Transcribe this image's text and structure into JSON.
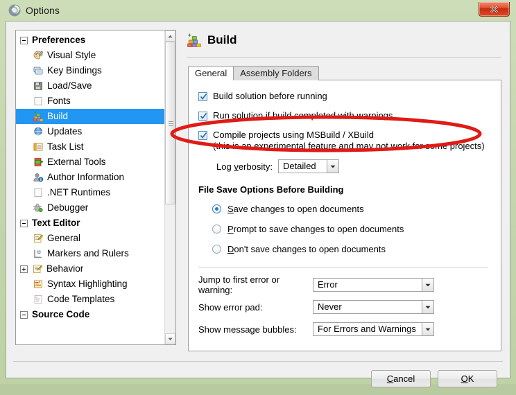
{
  "window": {
    "title": "Options",
    "icon": "monodevelop-icon",
    "close_label": "x",
    "frame_color": "#c3d5ad",
    "accent_color": "#2196f3"
  },
  "sidebar": {
    "items": [
      {
        "label": "Preferences",
        "level": 0,
        "type": "group",
        "expander": "minus",
        "icon": "none"
      },
      {
        "label": "Visual Style",
        "level": 1,
        "type": "item",
        "icon": "palette-icon"
      },
      {
        "label": "Key Bindings",
        "level": 1,
        "type": "item",
        "icon": "keyboard-icon"
      },
      {
        "label": "Load/Save",
        "level": 1,
        "type": "item",
        "icon": "disk-icon"
      },
      {
        "label": "Fonts",
        "level": 1,
        "type": "item",
        "icon": "blank-page-icon"
      },
      {
        "label": "Build",
        "level": 1,
        "type": "item",
        "icon": "build-blocks-icon",
        "selected": true
      },
      {
        "label": "Updates",
        "level": 1,
        "type": "item",
        "icon": "globe-icon"
      },
      {
        "label": "Task List",
        "level": 1,
        "type": "item",
        "icon": "list-icon"
      },
      {
        "label": "External Tools",
        "level": 1,
        "type": "item",
        "icon": "tools-icon"
      },
      {
        "label": "Author Information",
        "level": 1,
        "type": "item",
        "icon": "person-info-icon"
      },
      {
        "label": ".NET Runtimes",
        "level": 1,
        "type": "item",
        "icon": "blank-page-icon"
      },
      {
        "label": "Debugger",
        "level": 1,
        "type": "item",
        "icon": "bug-icon"
      },
      {
        "label": "Text Editor",
        "level": 0,
        "type": "group",
        "expander": "minus",
        "icon": "none"
      },
      {
        "label": "General",
        "level": 1,
        "type": "item",
        "icon": "pencil-pad-icon"
      },
      {
        "label": "Markers and Rulers",
        "level": 1,
        "type": "item",
        "icon": "ruler-icon"
      },
      {
        "label": "Behavior",
        "level": 1,
        "type": "item",
        "expander": "plus",
        "icon": "pencil-pad-icon"
      },
      {
        "label": "Syntax Highlighting",
        "level": 1,
        "type": "item",
        "icon": "highlight-icon"
      },
      {
        "label": "Code Templates",
        "level": 1,
        "type": "item",
        "icon": "template-icon"
      },
      {
        "label": "Source Code",
        "level": 0,
        "type": "group",
        "expander": "minus",
        "icon": "none"
      }
    ],
    "scrollbar": {
      "up_arrow": "▲",
      "down_arrow": "▼"
    }
  },
  "page": {
    "title": "Build",
    "icon": "build-blocks-icon",
    "tabs": [
      {
        "label": "General",
        "active": true
      },
      {
        "label": "Assembly Folders",
        "active": false
      }
    ],
    "checkboxes": [
      {
        "label": "Build solution before running",
        "checked": true
      },
      {
        "label": "Run solution if build completed with warnings",
        "checked": true
      },
      {
        "label": "Compile projects using MSBuild / XBuild",
        "sublabel": "(this is an experimental feature and may not work for some projects)",
        "checked": true,
        "annotated": true
      }
    ],
    "log_verbosity": {
      "label_before": "Log ",
      "label_accesskey": "v",
      "label_after": "erbosity:",
      "value": "Detailed"
    },
    "file_save_section": {
      "heading": "File Save Options Before Building",
      "options": [
        {
          "accesskey": "S",
          "rest": "ave changes to open documents",
          "selected": true
        },
        {
          "accesskey": "P",
          "rest": "rompt to save changes to open documents",
          "selected": false
        },
        {
          "accesskey": "D",
          "rest": "on't save changes to open documents",
          "selected": false
        }
      ]
    },
    "fields": [
      {
        "label": "Jump to first error or warning:",
        "value": "Error"
      },
      {
        "label": "Show error pad:",
        "value": "Never"
      },
      {
        "label": "Show message bubbles:",
        "value": "For Errors and Warnings"
      }
    ]
  },
  "footer": {
    "cancel": {
      "accesskey": "C",
      "rest": "ancel"
    },
    "ok": {
      "accesskey": "O",
      "rest": "K"
    }
  },
  "annotation": {
    "shape": "ellipse",
    "color": "#e01b16",
    "target": "Compile projects using MSBuild / XBuild"
  }
}
